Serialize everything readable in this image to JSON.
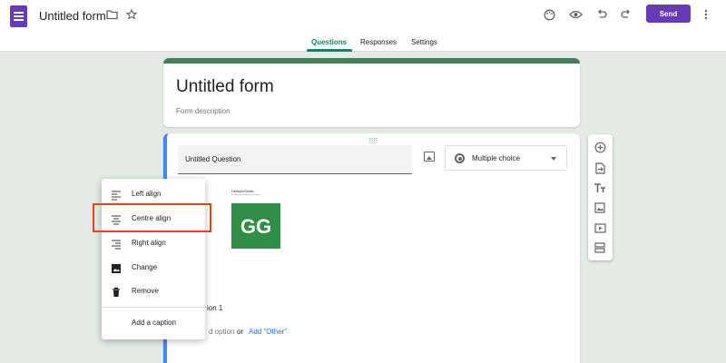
{
  "header": {
    "title": "Untitled form",
    "send_label": "Send",
    "icons": [
      "forms-app-icon",
      "folder-icon",
      "star-icon",
      "palette-icon",
      "eye-icon",
      "undo-icon",
      "redo-icon",
      "more-vert-icon"
    ]
  },
  "tabs": [
    {
      "label": "Questions",
      "active": true
    },
    {
      "label": "Responses",
      "active": false
    },
    {
      "label": "Settings",
      "active": false
    }
  ],
  "form": {
    "title": "Untitled form",
    "description": "Form description"
  },
  "question": {
    "title": "Untitled Question",
    "type": "Multiple choice",
    "image_caption": "GeeksforGeeks",
    "image_subtitle": "A computer science portal for geeks",
    "logo_text": "GG",
    "option_label": "ion 1",
    "add_option": "d option",
    "or_text": "or",
    "add_other": "Add \"Other\""
  },
  "context_menu": {
    "items": [
      {
        "label": "Left align",
        "icon": "format-align-left-icon"
      },
      {
        "label": "Centre align",
        "icon": "format-align-center-icon"
      },
      {
        "label": "Right align",
        "icon": "format-align-right-icon"
      },
      {
        "label": "Change",
        "icon": "image-icon"
      },
      {
        "label": "Remove",
        "icon": "trash-icon"
      },
      {
        "label": "Add a caption",
        "icon": ""
      }
    ],
    "highlighted": "Centre align"
  },
  "side_toolbar": {
    "tools": [
      "add-question-icon",
      "import-questions-icon",
      "add-title-icon",
      "add-image-icon",
      "add-video-icon",
      "add-section-icon"
    ]
  },
  "colors": {
    "accent": "#673ab7",
    "tab_active": "#1e7f5c",
    "theme_bar": "#467f5c",
    "background": "#e3ebe4",
    "question_border": "#4285f4",
    "highlight": "#e8451f",
    "gfg_green": "#2f8d46"
  }
}
